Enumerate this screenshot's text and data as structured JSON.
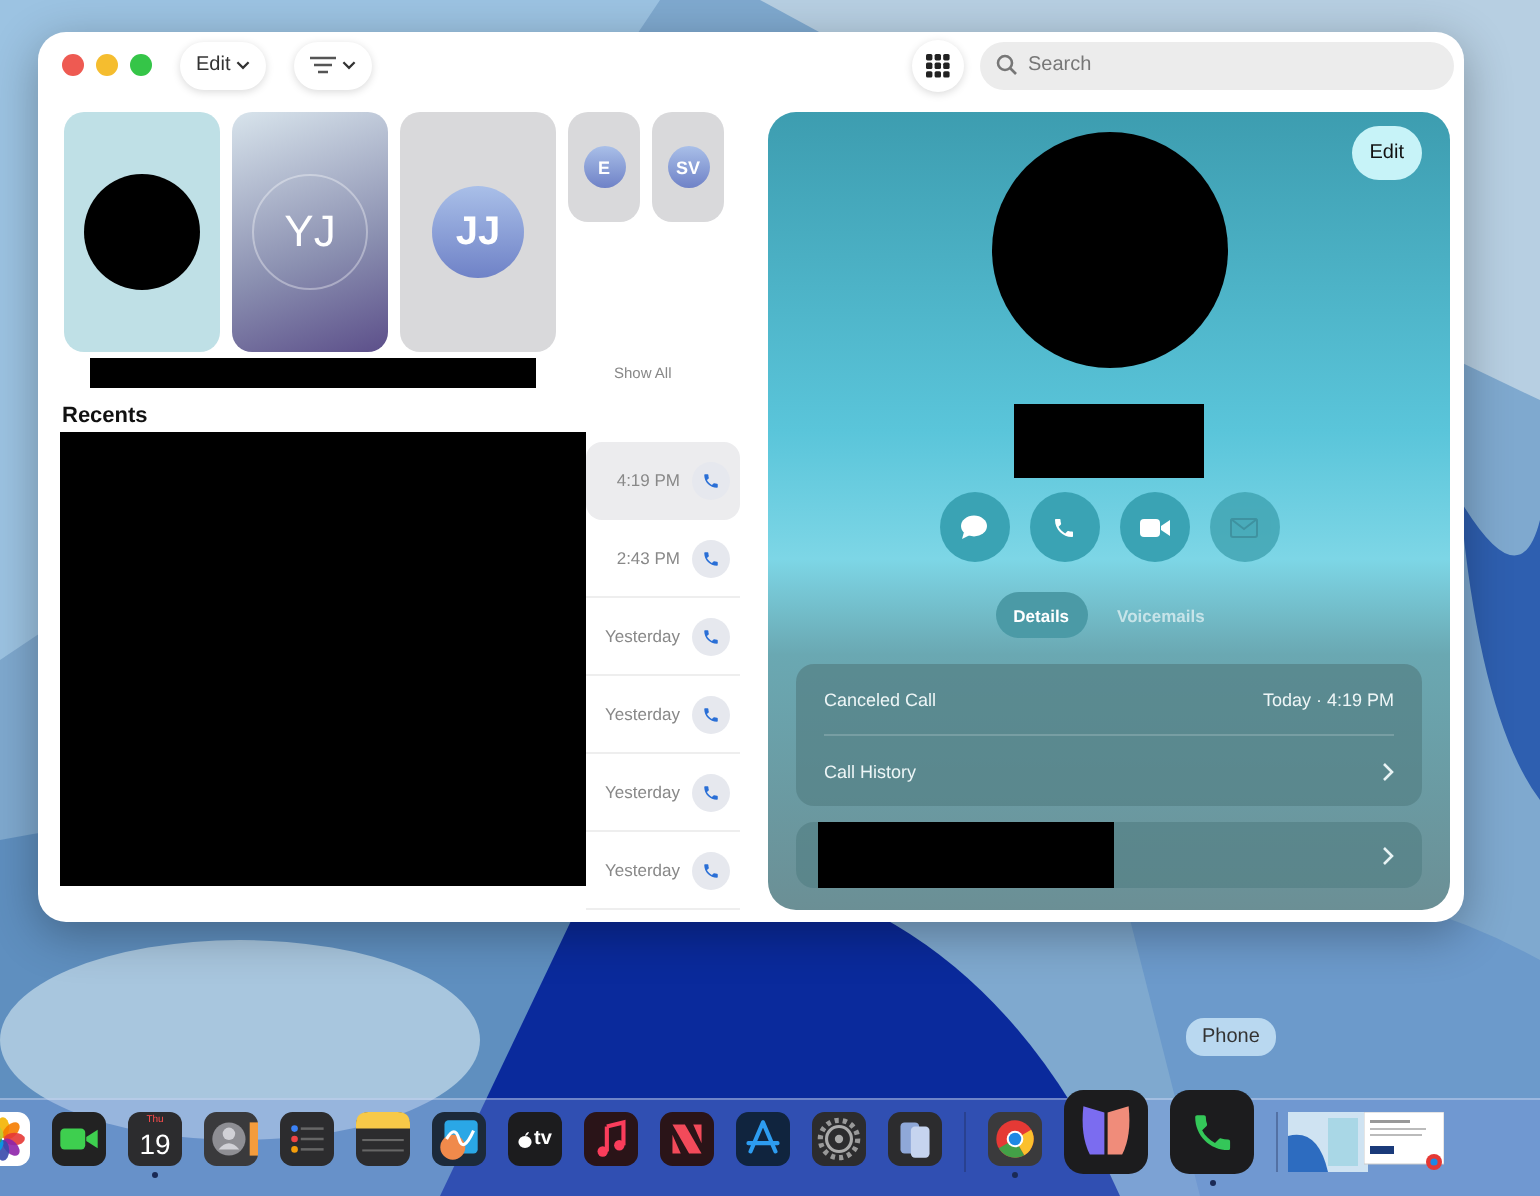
{
  "window": {
    "toolbar": {
      "edit_button": "Edit",
      "search": {
        "placeholder": "Search"
      }
    },
    "favorites": [
      {
        "kind": "redacted"
      },
      {
        "kind": "initials",
        "initials": "YJ"
      },
      {
        "kind": "initials",
        "initials": "JJ"
      }
    ],
    "more_favorites": [
      {
        "kind": "initials",
        "initials": "E"
      },
      {
        "kind": "initials",
        "initials": "SV"
      }
    ],
    "show_all": "Show All",
    "recents": {
      "title": "Recents",
      "rows": [
        {
          "time": "4:19 PM",
          "selected": true
        },
        {
          "time": "2:43 PM",
          "selected": false
        },
        {
          "time": "Yesterday",
          "selected": false
        },
        {
          "time": "Yesterday",
          "selected": false
        },
        {
          "time": "Yesterday",
          "selected": false
        },
        {
          "time": "Yesterday",
          "selected": false
        }
      ]
    },
    "detail": {
      "edit_button": "Edit",
      "actions": [
        {
          "kind": "message",
          "disabled": false
        },
        {
          "kind": "call",
          "disabled": false
        },
        {
          "kind": "video",
          "disabled": false
        },
        {
          "kind": "mail",
          "disabled": true
        }
      ],
      "tabs": [
        {
          "label": "Details",
          "selected": true
        },
        {
          "label": "Voicemails",
          "selected": false
        }
      ],
      "event": {
        "label": "Canceled Call",
        "time": "Today · 4:19 PM"
      },
      "history": "Call History"
    }
  },
  "dock": {
    "tooltip": "Phone",
    "items": [
      {
        "kind": "photos",
        "running": false
      },
      {
        "kind": "facetime",
        "running": false
      },
      {
        "kind": "calendar",
        "label": "Thu",
        "sublabel": "19",
        "running": true
      },
      {
        "kind": "contacts",
        "running": false
      },
      {
        "kind": "reminders",
        "running": false
      },
      {
        "kind": "notes",
        "running": false
      },
      {
        "kind": "freeform",
        "running": false
      },
      {
        "kind": "tv",
        "label": "tv",
        "running": false
      },
      {
        "kind": "music",
        "running": false
      },
      {
        "kind": "news",
        "running": false
      },
      {
        "kind": "appstore",
        "running": false
      },
      {
        "kind": "settings",
        "running": false
      },
      {
        "kind": "mirroring",
        "running": false
      },
      {
        "kind": "divider"
      },
      {
        "kind": "chrome",
        "running": true
      },
      {
        "kind": "butterfly",
        "running": false
      },
      {
        "kind": "phone",
        "running": true
      },
      {
        "kind": "divider"
      },
      {
        "kind": "thumb-desktop"
      },
      {
        "kind": "thumb-document"
      }
    ]
  }
}
